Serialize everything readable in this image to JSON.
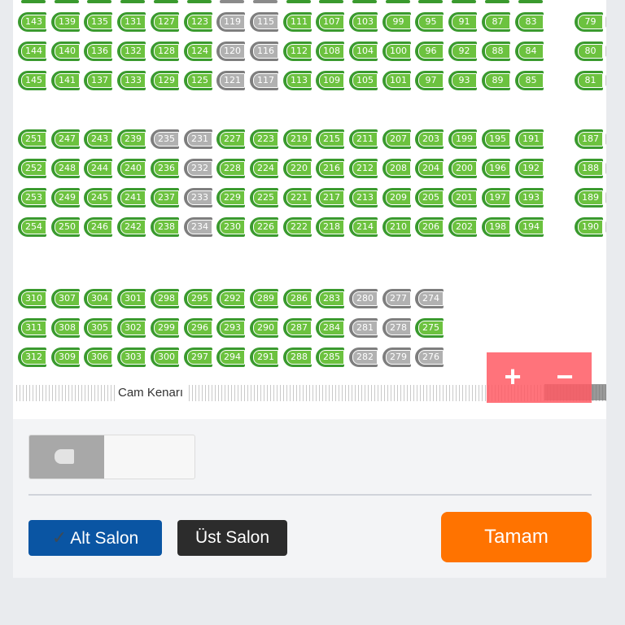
{
  "seat_map": {
    "window_label": "Cam Kenarı",
    "block_a": {
      "rows": [
        {
          "seats": [
            "143",
            "139",
            "135",
            "131",
            "127",
            "123",
            "119",
            "115",
            "111",
            "107",
            "103",
            "99",
            "95",
            "91",
            "87",
            "83"
          ],
          "taken": [
            "119",
            "115"
          ]
        },
        {
          "seats": [
            "144",
            "140",
            "136",
            "132",
            "128",
            "124",
            "120",
            "116",
            "112",
            "108",
            "104",
            "100",
            "96",
            "92",
            "88",
            "84"
          ],
          "taken": [
            "120",
            "116"
          ]
        },
        {
          "seats": [
            "145",
            "141",
            "137",
            "133",
            "129",
            "125",
            "121",
            "117",
            "113",
            "109",
            "105",
            "101",
            "97",
            "93",
            "89",
            "85"
          ],
          "taken": [
            "121",
            "117"
          ]
        }
      ],
      "right_seats": [
        "79",
        "80",
        "81"
      ]
    },
    "block_b": {
      "rows": [
        {
          "seats": [
            "251",
            "247",
            "243",
            "239",
            "235",
            "231",
            "227",
            "223",
            "219",
            "215",
            "211",
            "207",
            "203",
            "199",
            "195",
            "191"
          ],
          "taken": [
            "235",
            "231"
          ]
        },
        {
          "seats": [
            "252",
            "248",
            "244",
            "240",
            "236",
            "232",
            "228",
            "224",
            "220",
            "216",
            "212",
            "208",
            "204",
            "200",
            "196",
            "192"
          ],
          "taken": [
            "232"
          ]
        },
        {
          "seats": [
            "253",
            "249",
            "245",
            "241",
            "237",
            "233",
            "229",
            "225",
            "221",
            "217",
            "213",
            "209",
            "205",
            "201",
            "197",
            "193"
          ],
          "taken": [
            "233"
          ]
        },
        {
          "seats": [
            "254",
            "250",
            "246",
            "242",
            "238",
            "234",
            "230",
            "226",
            "222",
            "218",
            "214",
            "210",
            "206",
            "202",
            "198",
            "194"
          ],
          "taken": [
            "234"
          ]
        }
      ],
      "right_seats": [
        "187",
        "188",
        "189",
        "190"
      ]
    },
    "block_c": {
      "rows": [
        {
          "seats": [
            "310",
            "307",
            "304",
            "301",
            "298",
            "295",
            "292",
            "289",
            "286",
            "283",
            "280",
            "277",
            "274"
          ],
          "taken": [
            "280",
            "277",
            "274"
          ]
        },
        {
          "seats": [
            "311",
            "308",
            "305",
            "302",
            "299",
            "296",
            "293",
            "290",
            "287",
            "284",
            "281",
            "278",
            "275"
          ],
          "taken": [
            "281",
            "278"
          ]
        },
        {
          "seats": [
            "312",
            "309",
            "306",
            "303",
            "300",
            "297",
            "294",
            "291",
            "288",
            "285",
            "282",
            "279",
            "276"
          ],
          "taken": [
            "282",
            "279",
            "276"
          ]
        }
      ]
    },
    "zoom_in_label": "+",
    "zoom_out_label": "−"
  },
  "buttons": {
    "alt_salon": "Alt Salon",
    "alt_salon_check": "✓",
    "ust_salon": "Üst Salon",
    "tamam": "Tamam"
  },
  "colors": {
    "available": "#6cc23f",
    "taken": "#b1b1b1",
    "tamam": "#ff7300",
    "alt_salon": "#0a55a3",
    "ust_salon": "#2c2c2c"
  }
}
